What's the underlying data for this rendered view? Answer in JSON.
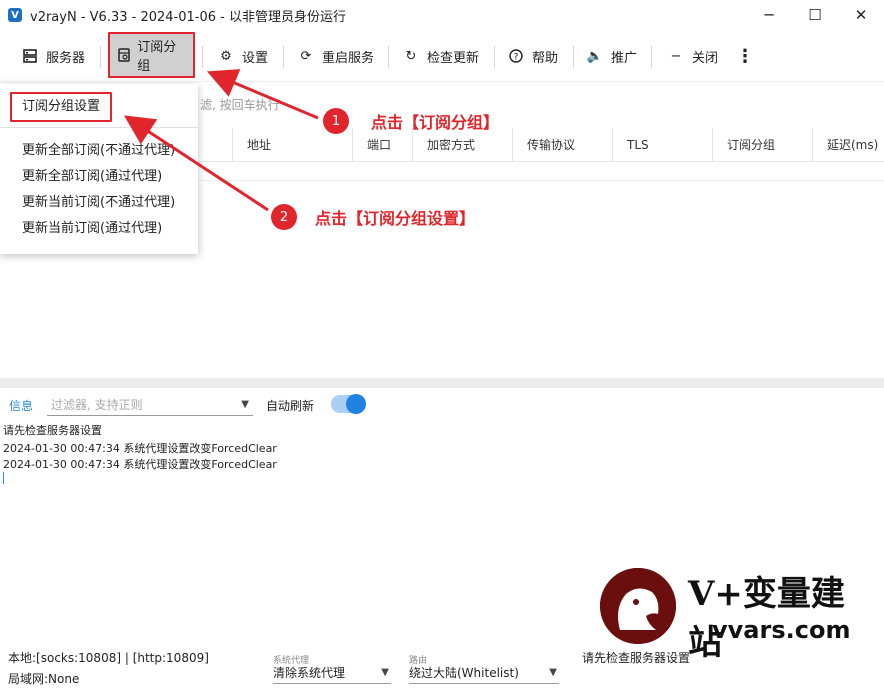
{
  "window": {
    "title": "v2rayN - V6.33 - 2024-01-06 - 以非管理员身份运行",
    "controls": [
      "─",
      "☐",
      "✕"
    ]
  },
  "toolbar": {
    "servers": "服务器",
    "subscription_group": "订阅分组",
    "settings": "设置",
    "restart_service": "重启服务",
    "check_update": "检查更新",
    "help": "帮助",
    "promote": "推广",
    "close": "关闭",
    "more": "⋮"
  },
  "filter_hint": "滤, 按回车执行",
  "table": {
    "columns": [
      "地址",
      "端口",
      "加密方式",
      "传输协议",
      "TLS",
      "订阅分组",
      "延迟(ms)"
    ]
  },
  "dropdown": {
    "items": [
      "订阅分组设置",
      "更新全部订阅(不通过代理)",
      "更新全部订阅(通过代理)",
      "更新当前订阅(不通过代理)",
      "更新当前订阅(通过代理)"
    ]
  },
  "annotations": [
    {
      "number": "1",
      "text": "点击【订阅分组】"
    },
    {
      "number": "2",
      "text": "点击【订阅分组设置】"
    }
  ],
  "log": {
    "tab": "信息",
    "filter_placeholder": "过滤器, 支持正则",
    "auto_refresh": "自动刷新",
    "auto_refresh_on": true,
    "lines": [
      "请先检查服务器设置",
      "2024-01-30 00:47:34 系统代理设置改变ForcedClear",
      "2024-01-30 00:47:34 系统代理设置改变ForcedClear"
    ]
  },
  "statusbar": {
    "local": "本地:[socks:10808] | [http:10809]",
    "lan": "局域网:None",
    "sys_proxy_label": "系统代理",
    "sys_proxy_value": "清除系统代理",
    "routing_label": "路由",
    "routing_value": "绕过大陆(Whitelist)",
    "message": "请先检查服务器设置"
  },
  "watermark": {
    "title": "V+变量建站",
    "subtitle": "vvars.com"
  },
  "colors": {
    "accent_red": "#e0262c",
    "accent_blue": "#1f82e0"
  }
}
